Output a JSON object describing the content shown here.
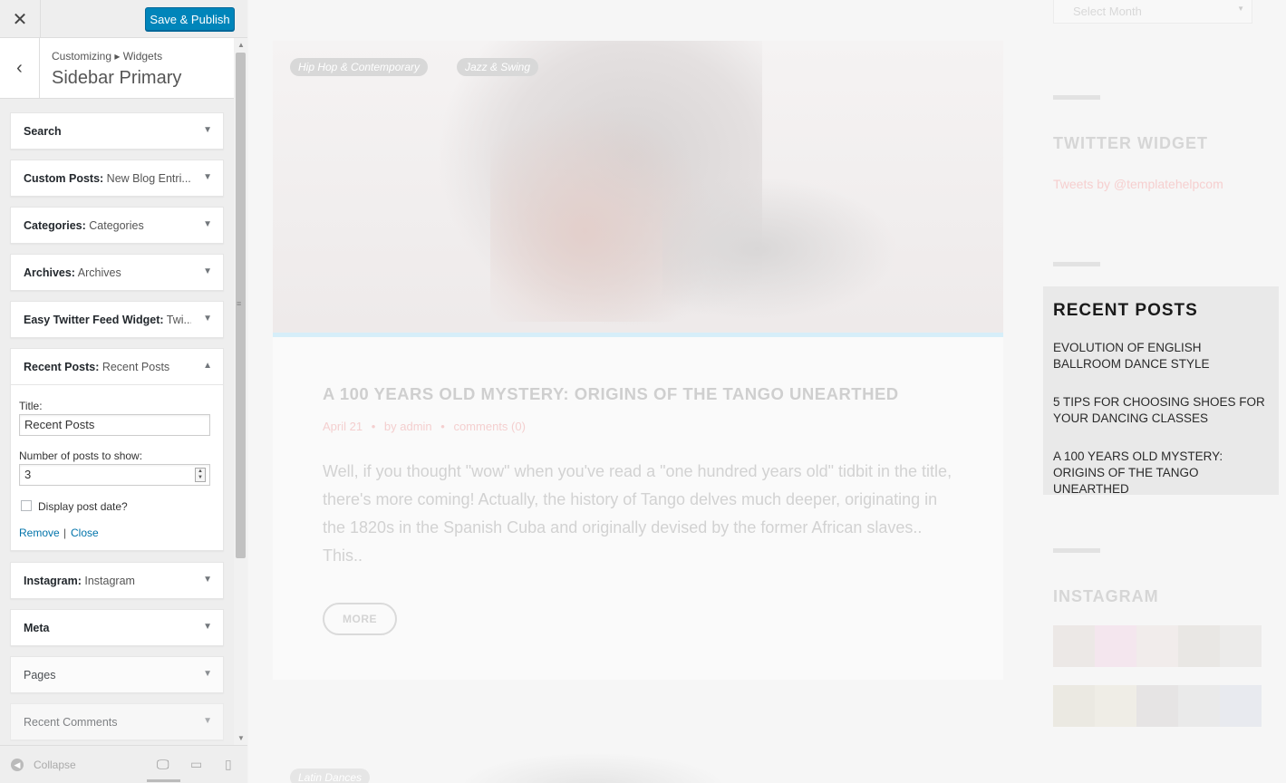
{
  "customizer": {
    "close_icon": "close-icon",
    "save_label": "Save & Publish",
    "back_icon": "chevron-left-icon",
    "breadcrumb": "Customizing ▸ Widgets",
    "section_title": "Sidebar Primary",
    "widgets": [
      {
        "name": "Search",
        "subtitle": ""
      },
      {
        "name": "Custom Posts:",
        "subtitle": " New Blog Entri..."
      },
      {
        "name": "Categories:",
        "subtitle": " Categories"
      },
      {
        "name": "Archives:",
        "subtitle": " Archives"
      },
      {
        "name": "Easy Twitter Feed Widget:",
        "subtitle": " Twi..."
      },
      {
        "name": "Recent Posts:",
        "subtitle": " Recent Posts"
      },
      {
        "name": "Instagram:",
        "subtitle": " Instagram"
      },
      {
        "name": "Meta",
        "subtitle": ""
      },
      {
        "name": "Pages",
        "subtitle": ""
      },
      {
        "name": "Recent Comments",
        "subtitle": ""
      }
    ],
    "recent_posts_form": {
      "title_label": "Title:",
      "title_value": "Recent Posts",
      "number_label": "Number of posts to show:",
      "number_value": "3",
      "display_date_label": "Display post date?",
      "display_date_checked": false,
      "remove_label": "Remove",
      "separator": "|",
      "close_label": "Close"
    },
    "footer": {
      "collapse_label": "Collapse"
    }
  },
  "preview": {
    "post": {
      "tags": [
        "Hip Hop & Contemporary",
        "Jazz & Swing"
      ],
      "title": "A 100 YEARS OLD MYSTERY: ORIGINS OF THE TANGO UNEARTHED",
      "date": "April 21",
      "author": "by admin",
      "comments": "comments (0)",
      "meta_dot": "•",
      "excerpt": "Well, if you thought \"wow\" when you've read a \"one hundred years old\" tidbit in the title, there's more coming! Actually, the history of Tango delves much deeper, originating in the 1820s in the Spanish Cuba and originally devised by the former African slaves.. This..",
      "more_label": "MORE"
    },
    "next_post_tag": "Latin Dances",
    "sidebar": {
      "archives_select": "Select Month",
      "twitter_heading": "TWITTER WIDGET",
      "twitter_link": "Tweets by @templatehelpcom",
      "recent_heading": "RECENT POSTS",
      "recent_items": [
        "EVOLUTION OF ENGLISH BALLROOM DANCE STYLE",
        "5 TIPS FOR CHOOSING SHOES FOR YOUR DANCING CLASSES",
        "A 100 YEARS OLD MYSTERY: ORIGINS OF THE TANGO UNEARTHED"
      ],
      "instagram_heading": "INSTAGRAM"
    }
  },
  "colors": {
    "primary_button": "#0085ba",
    "link": "#0073aa",
    "panel_bg": "#eeeeee"
  }
}
